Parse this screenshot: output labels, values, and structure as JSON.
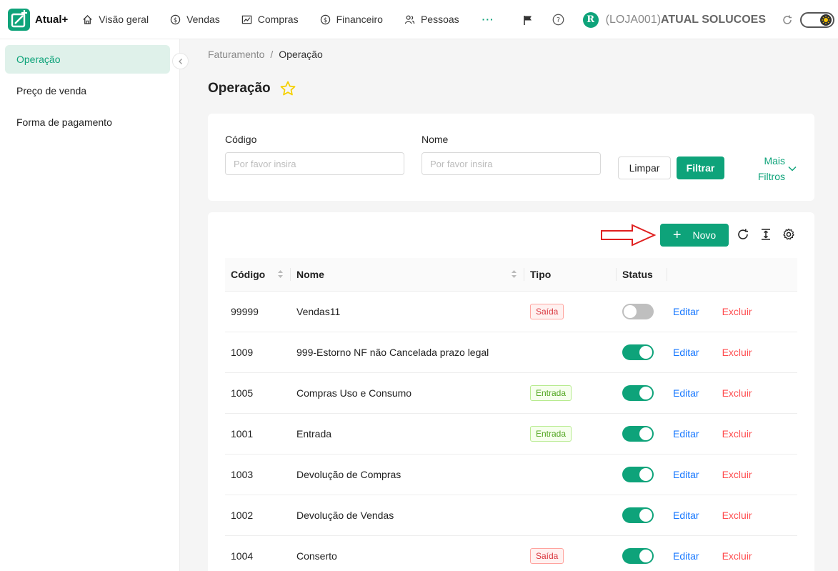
{
  "app": {
    "name": "Atual+"
  },
  "nav": [
    {
      "label": "Visão geral",
      "icon": "home-icon"
    },
    {
      "label": "Vendas",
      "icon": "dollar-circle-icon"
    },
    {
      "label": "Compras",
      "icon": "line-chart-icon"
    },
    {
      "label": "Financeiro",
      "icon": "dollar-circle-icon"
    },
    {
      "label": "Pessoas",
      "icon": "people-icon"
    }
  ],
  "nav_more": "···",
  "user": {
    "avatar": "R",
    "store_code": "(LOJA001)",
    "store_name": "ATUAL SOLUCOES"
  },
  "sidebar": [
    {
      "label": "Operação",
      "active": true
    },
    {
      "label": "Preço de venda",
      "active": false
    },
    {
      "label": "Forma de pagamento",
      "active": false
    }
  ],
  "breadcrumb": {
    "parent": "Faturamento",
    "sep": "/",
    "current": "Operação"
  },
  "page_title": "Operação",
  "filters": {
    "codigo_label": "Código",
    "codigo_placeholder": "Por favor insira",
    "nome_label": "Nome",
    "nome_placeholder": "Por favor insira",
    "limpar": "Limpar",
    "filtrar": "Filtrar",
    "mais_filtros": "Mais Filtros"
  },
  "toolbar": {
    "novo": "Novo"
  },
  "table": {
    "headers": {
      "codigo": "Código",
      "nome": "Nome",
      "tipo": "Tipo",
      "status": "Status"
    },
    "actions": {
      "edit": "Editar",
      "delete": "Excluir"
    },
    "rows": [
      {
        "codigo": "99999",
        "nome": "Vendas11",
        "tipo": "Saída",
        "status": false
      },
      {
        "codigo": "1009",
        "nome": "999-Estorno NF não Cancelada prazo legal",
        "tipo": "",
        "status": true
      },
      {
        "codigo": "1005",
        "nome": "Compras Uso e Consumo",
        "tipo": "Entrada",
        "status": true
      },
      {
        "codigo": "1001",
        "nome": "Entrada",
        "tipo": "Entrada",
        "status": true
      },
      {
        "codigo": "1003",
        "nome": "Devolução de Compras",
        "tipo": "",
        "status": true
      },
      {
        "codigo": "1002",
        "nome": "Devolução de Vendas",
        "tipo": "",
        "status": true
      },
      {
        "codigo": "1004",
        "nome": "Conserto",
        "tipo": "Saída",
        "status": true
      }
    ]
  },
  "colors": {
    "primary": "#0ea37a",
    "danger": "#ff4d4f",
    "link": "#1677ff"
  }
}
